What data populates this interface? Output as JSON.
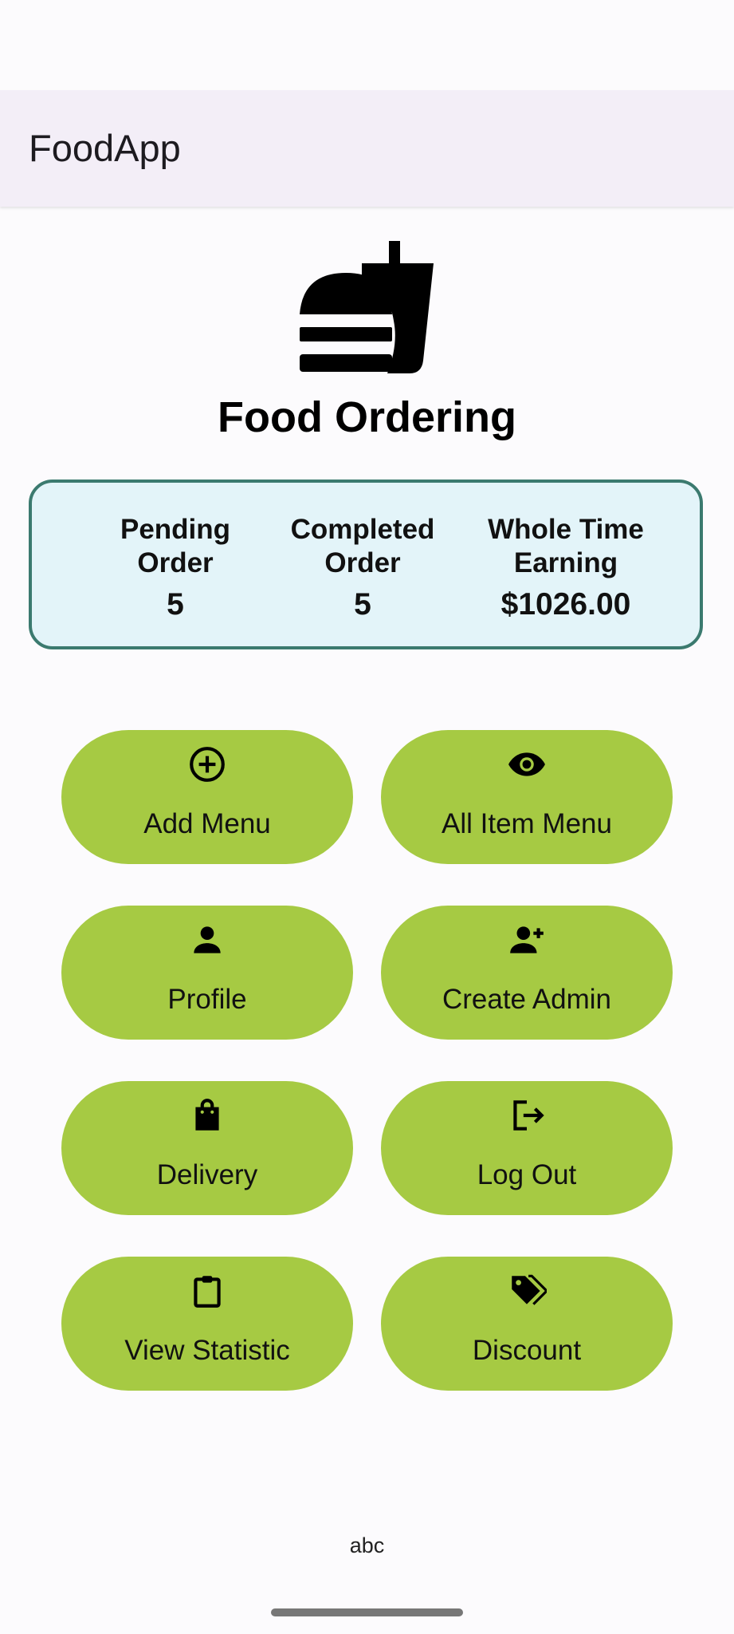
{
  "app_bar": {
    "title": "FoodApp"
  },
  "header": {
    "logo_icon": "fastfood-icon",
    "title": "Food Ordering"
  },
  "stats": [
    {
      "label": "Pending\nOrder",
      "value": "5"
    },
    {
      "label": "Completed\nOrder",
      "value": "5"
    },
    {
      "label": "Whole Time\nEarning",
      "value": "$1026.00"
    }
  ],
  "actions": [
    {
      "label": "Add Menu",
      "icon": "add-circle-icon"
    },
    {
      "label": "All Item Menu",
      "icon": "eye-icon"
    },
    {
      "label": "Profile",
      "icon": "person-icon"
    },
    {
      "label": "Create Admin",
      "icon": "person-add-icon"
    },
    {
      "label": "Delivery",
      "icon": "shopping-bag-icon"
    },
    {
      "label": "Log Out",
      "icon": "logout-icon"
    },
    {
      "label": "View Statistic",
      "icon": "clipboard-icon"
    },
    {
      "label": "Discount",
      "icon": "tags-icon"
    }
  ],
  "footer": {
    "text": "abc"
  },
  "colors": {
    "app_bar_bg": "#f3eef7",
    "button_green": "#a6ca43",
    "card_bg": "#e3f4f9",
    "card_border": "#3b7a6f"
  }
}
